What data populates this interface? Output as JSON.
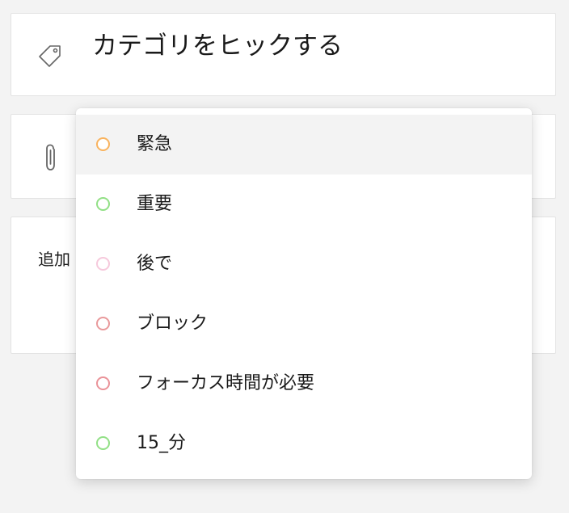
{
  "category_card": {
    "title": "カテゴリをヒックする",
    "icon": "tag-icon"
  },
  "attachment_card": {
    "icon": "paperclip-icon"
  },
  "note_card": {
    "label": "追加"
  },
  "category_menu": {
    "items": [
      {
        "label": "緊急",
        "color": "#f9b35e",
        "hovered": true
      },
      {
        "label": "重要",
        "color": "#92e086",
        "hovered": false
      },
      {
        "label": "後で",
        "color": "#f6c9dc",
        "hovered": false
      },
      {
        "label": "ブロック",
        "color": "#e99a9c",
        "hovered": false
      },
      {
        "label": "フォーカス時間が必要",
        "color": "#ea9399",
        "hovered": false
      },
      {
        "label": "15_分",
        "color": "#92e086",
        "hovered": false
      }
    ]
  }
}
